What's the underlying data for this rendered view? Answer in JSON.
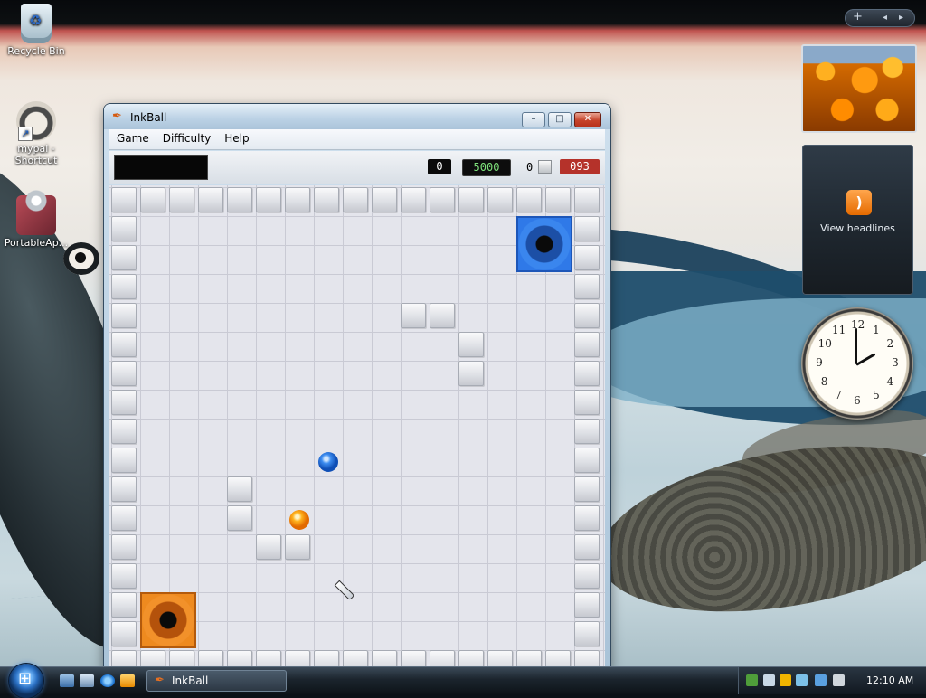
{
  "desktop": {
    "icons": [
      {
        "label": "Recycle Bin"
      },
      {
        "label": "mypal - Shortcut"
      },
      {
        "label": "PortableAp..."
      }
    ]
  },
  "sidebar": {
    "controls": {
      "add": "+",
      "prev": "◂",
      "next": "▸"
    },
    "feed_gadget": {
      "label": "View headlines",
      "icon": "rss-feed-icon"
    },
    "clock": {
      "hours": [
        "12",
        "1",
        "2",
        "3",
        "4",
        "5",
        "6",
        "7",
        "8",
        "9",
        "10",
        "11"
      ],
      "time_shown": "12:10"
    }
  },
  "window": {
    "title": "InkBall",
    "controls": {
      "minimize": "–",
      "maximize": "□",
      "close": "✕"
    },
    "menu": [
      "Game",
      "Difficulty",
      "Help"
    ],
    "scorebar": {
      "score": "0",
      "target": "5000",
      "blocks_count": "0",
      "timer": "093"
    }
  },
  "game": {
    "grid_cols": 17,
    "grid_rows": 17,
    "obstacles": [
      [
        10,
        4
      ],
      [
        11,
        4
      ],
      [
        12,
        5
      ],
      [
        12,
        6
      ],
      [
        4,
        10
      ],
      [
        4,
        11
      ],
      [
        5,
        12
      ],
      [
        6,
        12
      ]
    ],
    "holes": [
      {
        "color": "blue",
        "col": 14,
        "row": 1
      },
      {
        "color": "orange",
        "col": 1,
        "row": 14
      }
    ],
    "balls": [
      {
        "color": "blue",
        "col": 7,
        "row": 9
      },
      {
        "color": "orange",
        "col": 6,
        "row": 11
      }
    ]
  },
  "taskbar": {
    "start_label": "Start",
    "task": "InkBall",
    "quicklaunch": [
      "show-desktop-icon",
      "switch-windows-icon",
      "internet-explorer-icon",
      "media-player-icon"
    ],
    "tray_icons": [
      "network-icon",
      "security-icon",
      "shield-icon",
      "safely-remove-icon",
      "network-status-icon",
      "volume-muted-icon"
    ],
    "time": "12:10 AM"
  },
  "colors": {
    "blue": "#2f79e8",
    "orange": "#ee8a1f",
    "timer": "#b5322a",
    "target": "#7ee07a"
  }
}
